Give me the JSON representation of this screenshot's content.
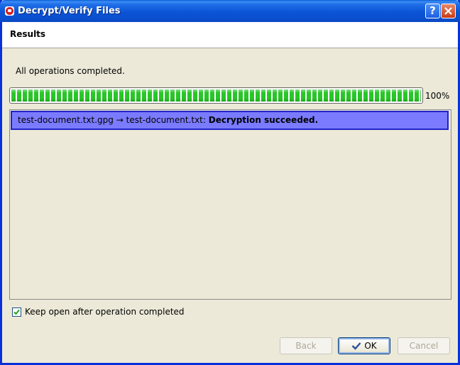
{
  "window": {
    "title": "Decrypt/Verify Files"
  },
  "header": {
    "title": "Results"
  },
  "status": {
    "text": "All operations completed.",
    "progress": 1.0,
    "percent_label": "100%"
  },
  "results": [
    {
      "source": "test-document.txt.gpg",
      "arrow": "→",
      "target": "test-document.txt:",
      "message": "Decryption succeeded."
    }
  ],
  "options": {
    "keep_open_label": "Keep open after operation completed",
    "keep_open_checked": true
  },
  "buttons": {
    "back": "Back",
    "ok": "OK",
    "cancel": "Cancel"
  },
  "colors": {
    "progress_fill": "#28c628",
    "selection": "#7b7bff",
    "titlebar": "#0a54d6"
  }
}
